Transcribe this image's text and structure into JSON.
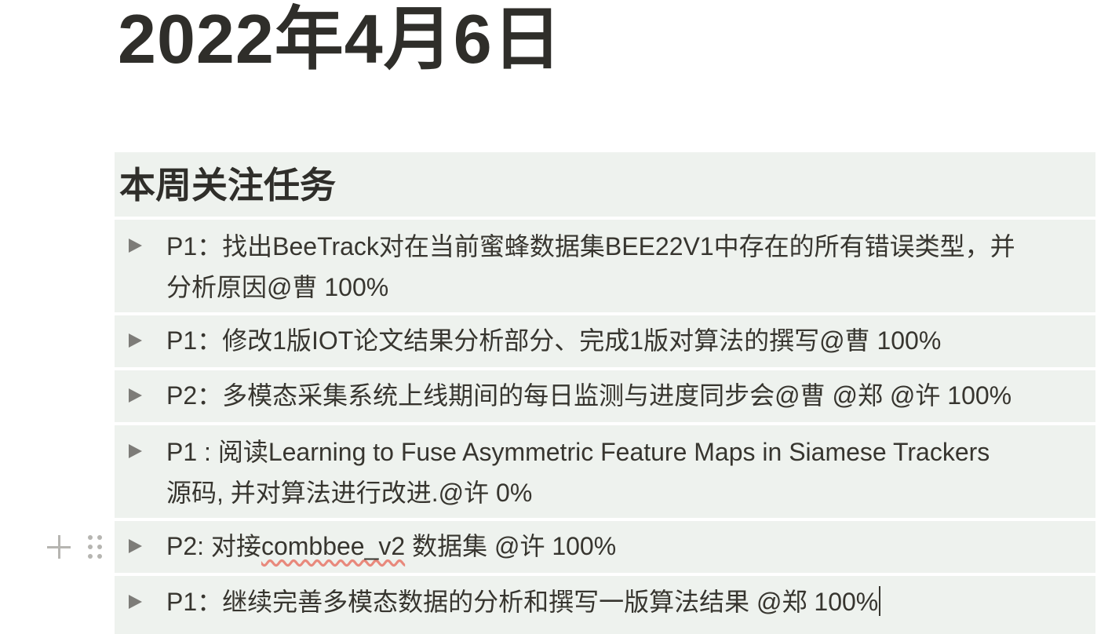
{
  "page": {
    "title": "2022年4月6日"
  },
  "section": {
    "heading": "本周关注任务"
  },
  "tasks": [
    {
      "lines": [
        "P1：找出BeeTrack对在当前蜜蜂数据集BEE22V1中存在的所有错误类型，并",
        "分析原因@曹 100%"
      ]
    },
    {
      "lines": [
        "P1：修改1版IOT论文结果分析部分、完成1版对算法的撰写@曹  100%"
      ]
    },
    {
      "lines": [
        "P2：多模态采集系统上线期间的每日监测与进度同步会@曹 @郑 @许 100%"
      ]
    },
    {
      "lines": [
        "P1 : 阅读Learning to Fuse Asymmetric Feature Maps in Siamese Trackers",
        "源码, 并对算法进行改进.@许 0%"
      ]
    },
    {
      "prefix": "P2: 对接",
      "misspelled": "combbee_v2",
      "suffix": " 数据集 @许 100%"
    },
    {
      "lines": [
        "P1：继续完善多模态数据的分析和撰写一版算法结果 @郑 100%"
      ]
    }
  ],
  "icons": {
    "toggle": "triangle-right-icon",
    "add": "plus-icon",
    "drag": "drag-handle-icon"
  },
  "colors": {
    "callout_background": "#eef2ee",
    "text": "#37352f",
    "spellcheck": "#e8897c"
  }
}
